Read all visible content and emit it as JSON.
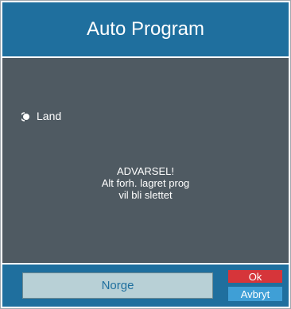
{
  "dialog": {
    "title": "Auto Program"
  },
  "content": {
    "option_label": "Land",
    "warning_line1": "ADVARSEL!",
    "warning_line2": "Alt forh. lagret prog",
    "warning_line3": "vil bli slettet"
  },
  "footer": {
    "country_value": "Norge",
    "ok_label": "Ok",
    "cancel_label": "Avbryt"
  },
  "colors": {
    "header_blue": "#1f6f9e",
    "content_gray": "#4f5a62",
    "ok_red": "#d6353a",
    "cancel_blue": "#3f9fd6",
    "field_bg": "#b8d0d6"
  }
}
